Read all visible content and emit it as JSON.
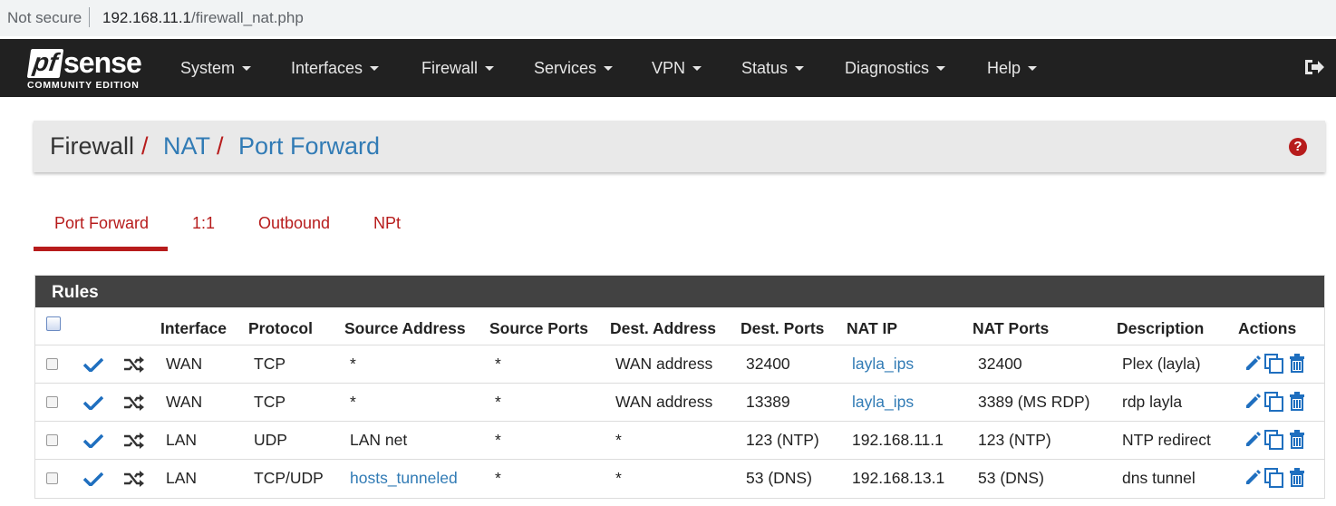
{
  "browser": {
    "security": "Not secure",
    "url_host": "192.168.11.1",
    "url_path": "/firewall_nat.php"
  },
  "nav": {
    "logo_pf": "pf",
    "logo_sense": "sense",
    "logo_edition": "COMMUNITY EDITION",
    "menus": [
      "System",
      "Interfaces",
      "Firewall",
      "Services",
      "VPN",
      "Status",
      "Diagnostics",
      "Help"
    ]
  },
  "breadcrumb": {
    "section": "Firewall",
    "separator": "/",
    "page": "NAT",
    "subpage": "Port Forward",
    "help_icon": "?"
  },
  "tabs": [
    "Port Forward",
    "1:1",
    "Outbound",
    "NPt"
  ],
  "rules": {
    "title": "Rules",
    "columns": [
      "Interface",
      "Protocol",
      "Source Address",
      "Source Ports",
      "Dest. Address",
      "Dest. Ports",
      "NAT IP",
      "NAT Ports",
      "Description",
      "Actions"
    ],
    "rows": [
      {
        "interface": "WAN",
        "protocol": "TCP",
        "src_addr": "*",
        "src_ports": "*",
        "dst_addr": "WAN address",
        "dst_ports": "32400",
        "nat_ip": "layla_ips",
        "nat_ports": "32400",
        "description": "Plex (layla)"
      },
      {
        "interface": "WAN",
        "protocol": "TCP",
        "src_addr": "*",
        "src_ports": "*",
        "dst_addr": "WAN address",
        "dst_ports": "13389",
        "nat_ip": "layla_ips",
        "nat_ports": "3389 (MS RDP)",
        "description": "rdp layla"
      },
      {
        "interface": "LAN",
        "protocol": "UDP",
        "src_addr": "LAN net",
        "src_ports": "*",
        "dst_addr": "*",
        "dst_ports": "123 (NTP)",
        "nat_ip": "192.168.11.1",
        "nat_ports": "123 (NTP)",
        "description": "NTP redirect"
      },
      {
        "interface": "LAN",
        "protocol": "TCP/UDP",
        "src_addr": "hosts_tunneled",
        "src_ports": "*",
        "dst_addr": "*",
        "dst_ports": "53 (DNS)",
        "nat_ip": "192.168.13.1",
        "nat_ports": "53 (DNS)",
        "description": "dns tunnel"
      }
    ]
  },
  "colors": {
    "navbar": "#212121",
    "accent_red": "#b71c1c",
    "link_blue": "#317bb5",
    "panel_header": "#424242",
    "breadcrumb_bg": "#e9e9e9"
  },
  "icons": {
    "row_status": "check-icon",
    "row_type": "shuffle-icon",
    "edit": "pencil-icon",
    "copy": "copy-icon",
    "delete": "trash-icon",
    "logout": "sign-out-icon",
    "help": "question-circle-icon"
  }
}
